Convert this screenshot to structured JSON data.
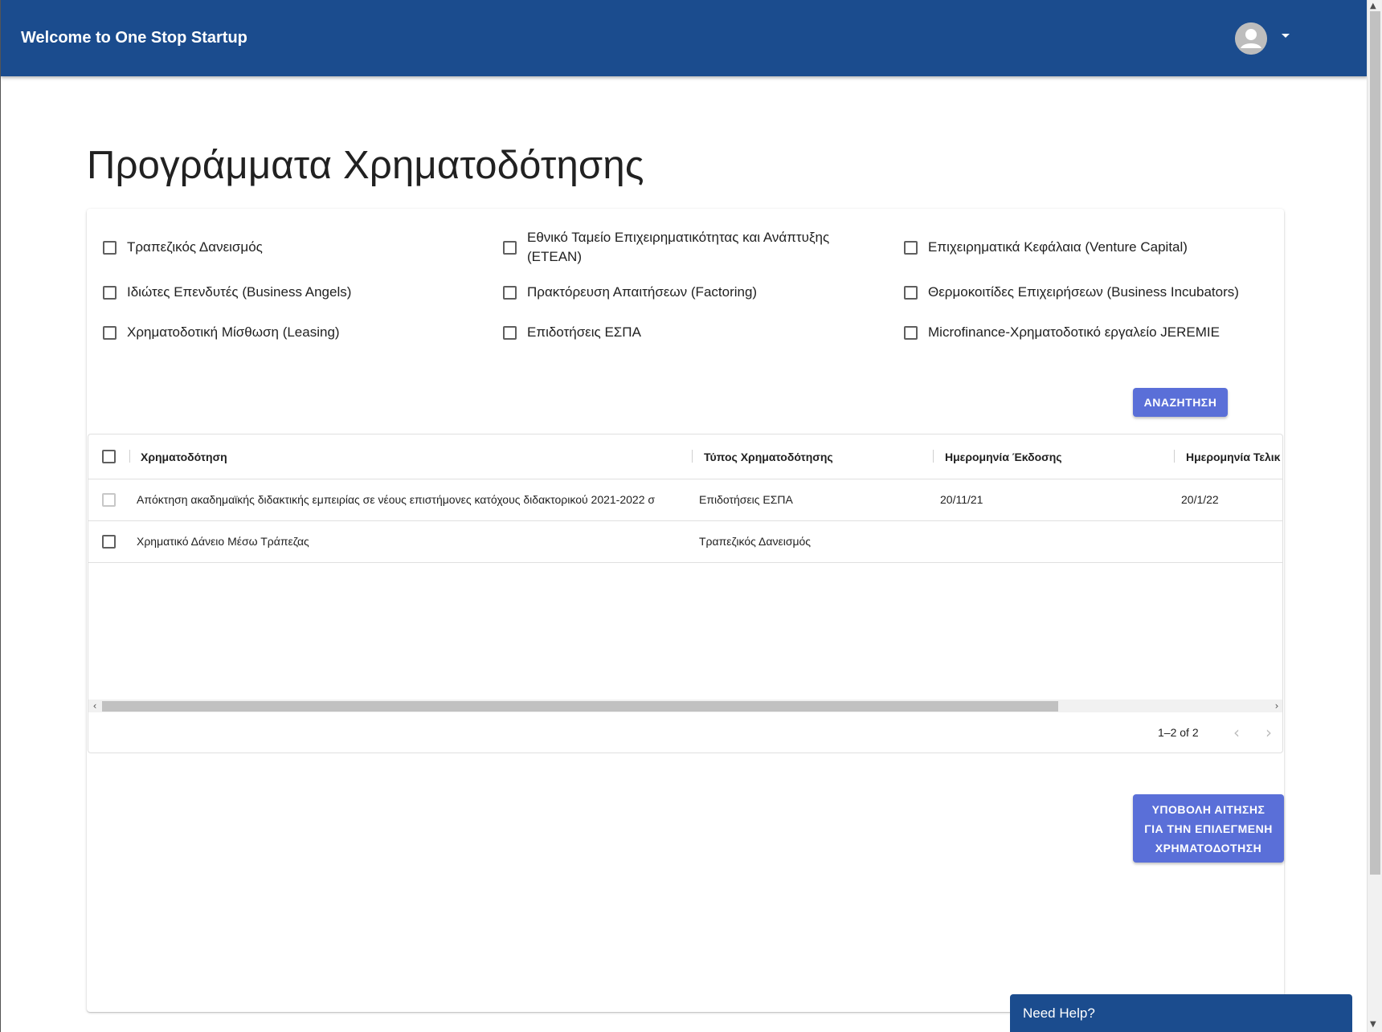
{
  "header": {
    "title": "Welcome to One Stop Startup",
    "avatar_icon": "account-circle-icon",
    "menu_icon": "arrow-drop-down-icon",
    "color": "#1b4c8e"
  },
  "page": {
    "title": "Προγράμματα Χρηματοδότησης"
  },
  "filters": [
    {
      "label": "Τραπεζικός Δανεισμός",
      "checked": false
    },
    {
      "label": "Εθνικό Ταμείο Επιχειρηματικότητας και Ανάπτυξης (ΕΤΕΑΝ)",
      "checked": false
    },
    {
      "label": "Επιχειρηματικά Κεφάλαια (Venture Capital)",
      "checked": false
    },
    {
      "label": "Ιδιώτες Επενδυτές (Business Angels)",
      "checked": false
    },
    {
      "label": "Πρακτόρευση Απαιτήσεων (Factoring)",
      "checked": false
    },
    {
      "label": "Θερμοκοιτίδες Επιχειρήσεων (Business Incubators)",
      "checked": false
    },
    {
      "label": "Χρηματοδοτική Μίσθωση (Leasing)",
      "checked": false
    },
    {
      "label": "Επιδοτήσεις ΕΣΠΑ",
      "checked": false
    },
    {
      "label": "Microfinance-Χρηματοδοτικό εργαλείο JEREMIE",
      "checked": false
    }
  ],
  "search_button": "ΑΝΑΖΗΤΗΣΗ",
  "grid": {
    "columns": [
      "Χρηματοδότηση",
      "Τύπος Χρηματοδότησης",
      "Ημερομηνία Έκδοσης",
      "Ημερομηνία Τελικ"
    ],
    "rows": [
      {
        "name": "Απόκτηση ακαδημαϊκής διδακτικής εμπειρίας σε νέους επιστήμονες κατόχους διδακτορικού 2021-2022 σ",
        "type": "Επιδοτήσεις ΕΣΠΑ",
        "issue_date": "20/11/21",
        "end_date": "20/1/22"
      },
      {
        "name": "Χρηματικό Δάνειο Μέσω Τράπεζας",
        "type": "Τραπεζικός Δανεισμός",
        "issue_date": "",
        "end_date": ""
      }
    ],
    "pagination": "1–2 of 2"
  },
  "submit_button": "ΥΠΟΒΟΛΗ ΑΙΤΗΣΗΣ ΓΙΑ ΤΗΝ ΕΠΙΛΕΓΜΕΝΗ ΧΡΗΜΑΤΟΔΟΤΗΣΗ",
  "help": {
    "label": "Need Help?"
  },
  "colors": {
    "primary": "#1b4c8e",
    "button": "#5a6fd8"
  }
}
